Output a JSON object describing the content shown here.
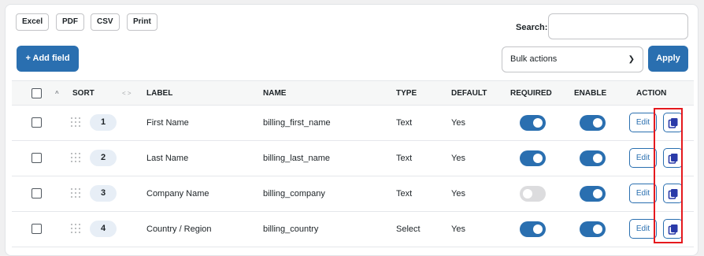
{
  "toolbar": {
    "export_buttons": [
      "Excel",
      "PDF",
      "CSV",
      "Print"
    ],
    "search_label": "Search:",
    "search_value": "",
    "add_field_label": "+ Add field",
    "bulk_actions_value": "Bulk actions",
    "apply_label": "Apply"
  },
  "table": {
    "columns": {
      "sort": "SORT",
      "sort_arrows": "< >",
      "sort_caret": "^",
      "label": "LABEL",
      "name": "NAME",
      "type": "TYPE",
      "default": "DEFAULT",
      "required": "REQUIRED",
      "enable": "ENABLE",
      "action": "ACTION"
    },
    "rows": [
      {
        "sort": "1",
        "label": "First Name",
        "name": "billing_first_name",
        "type": "Text",
        "default": "Yes",
        "required": true,
        "enable": true,
        "edit_label": "Edit"
      },
      {
        "sort": "2",
        "label": "Last Name",
        "name": "billing_last_name",
        "type": "Text",
        "default": "Yes",
        "required": true,
        "enable": true,
        "edit_label": "Edit"
      },
      {
        "sort": "3",
        "label": "Company Name",
        "name": "billing_company",
        "type": "Text",
        "default": "Yes",
        "required": false,
        "enable": true,
        "edit_label": "Edit"
      },
      {
        "sort": "4",
        "label": "Country / Region",
        "name": "billing_country",
        "type": "Select",
        "default": "Yes",
        "required": true,
        "enable": true,
        "edit_label": "Edit"
      }
    ]
  },
  "icons": {
    "drag": "drag-handle-icon",
    "copy": "copy-icon",
    "chevron": "chevron-down-icon"
  },
  "colors": {
    "accent": "#2a6fb0",
    "highlight": "#e5191e",
    "toggle_off": "#dcdcde"
  }
}
